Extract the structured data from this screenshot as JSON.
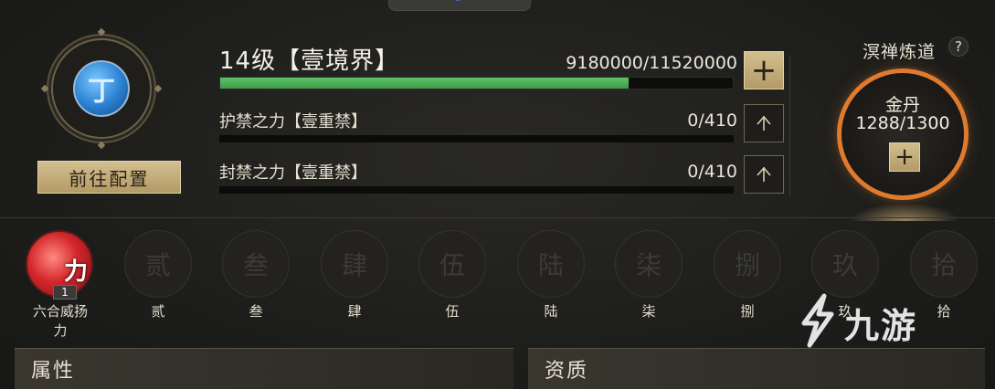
{
  "level": {
    "title": "14级【壹境界】",
    "exp_text": "9180000/11520000",
    "exp_progress": 0.797
  },
  "sub_stats": [
    {
      "label": "护禁之力【壹重禁】",
      "value": "0/410",
      "progress": 0
    },
    {
      "label": "封禁之力【壹重禁】",
      "value": "0/410",
      "progress": 0
    }
  ],
  "config_button": "前往配置",
  "emblem_glyph": "丁",
  "dial": {
    "title": "溟禅炼道",
    "help": "?",
    "name": "金丹",
    "value": "1288/1300",
    "plus": "+"
  },
  "plus_symbol": "+",
  "skills": [
    {
      "label": "六合威扬力",
      "label_line1": "六合威扬",
      "label_line2": "力",
      "icon_text": "力",
      "badge": "1",
      "active": true
    },
    {
      "label": "贰",
      "icon_text": "贰"
    },
    {
      "label": "叁",
      "icon_text": "叁"
    },
    {
      "label": "肆",
      "icon_text": "肆"
    },
    {
      "label": "伍",
      "icon_text": "伍"
    },
    {
      "label": "陆",
      "icon_text": "陆"
    },
    {
      "label": "柒",
      "icon_text": "柒"
    },
    {
      "label": "捌",
      "icon_text": "捌"
    },
    {
      "label": "玖",
      "icon_text": "玖"
    },
    {
      "label": "拾",
      "icon_text": "拾"
    }
  ],
  "panels": {
    "left_title": "属性",
    "right_title": "资质"
  },
  "watermark": "九游",
  "colors": {
    "accent_gold": "#c7b27f",
    "exp_green": "#4fb45c",
    "dial_orange": "#e07a2d"
  }
}
